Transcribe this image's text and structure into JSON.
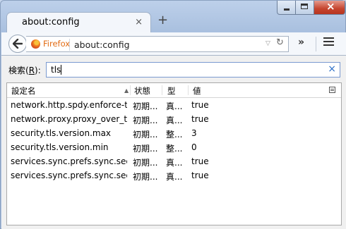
{
  "window": {
    "tab_title": "about:config",
    "tab_close": "×",
    "new_tab": "+",
    "controls": {
      "close_glyph": "×"
    }
  },
  "toolbar": {
    "back_icon": "back-arrow-icon",
    "identity_label": "Firefox",
    "url": "about:config",
    "dropdown_glyph": "▽",
    "reload_glyph": "↻",
    "overflow_glyph": "»",
    "menu_icon": "hamburger-menu-icon"
  },
  "search": {
    "label_prefix": "検索(",
    "label_key": "R",
    "label_suffix": "):",
    "value": "tls",
    "clear_glyph": "×"
  },
  "table": {
    "columns": [
      "設定名",
      "状態",
      "型",
      "値"
    ],
    "rows": [
      {
        "name": "network.http.spdy.enforce-tl...",
        "status": "初期...",
        "type": "真...",
        "value": "true"
      },
      {
        "name": "network.proxy.proxy_over_tls",
        "status": "初期...",
        "type": "真...",
        "value": "true"
      },
      {
        "name": "security.tls.version.max",
        "status": "初期...",
        "type": "整...",
        "value": "3"
      },
      {
        "name": "security.tls.version.min",
        "status": "初期...",
        "type": "整...",
        "value": "0"
      },
      {
        "name": "services.sync.prefs.sync.sec...",
        "status": "初期...",
        "type": "真...",
        "value": "true"
      },
      {
        "name": "services.sync.prefs.sync.sec...",
        "status": "初期...",
        "type": "真...",
        "value": "true"
      }
    ]
  },
  "colors": {
    "accent": "#2c6fc7",
    "firefox_orange": "#e26b13",
    "close_red": "#c5442e"
  }
}
